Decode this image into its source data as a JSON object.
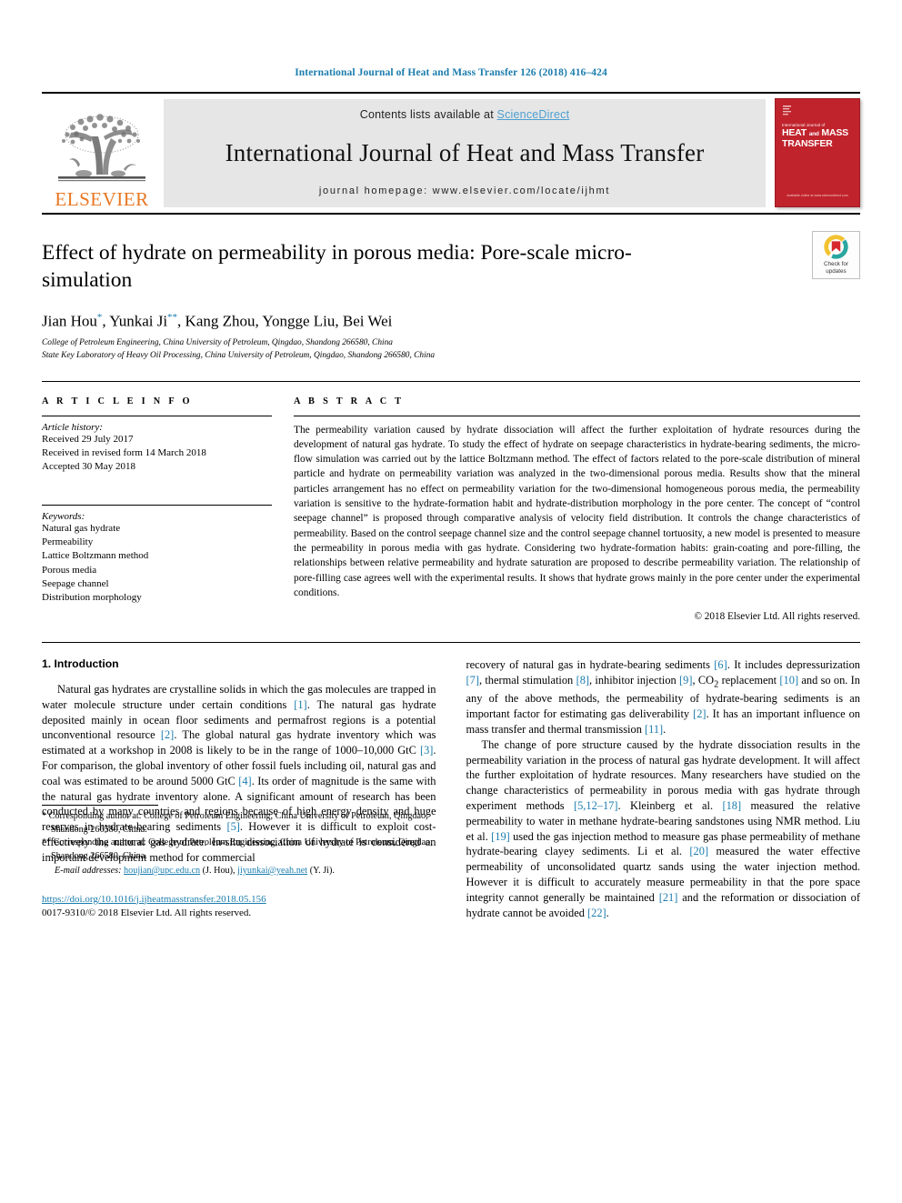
{
  "running_head": "International Journal of Heat and Mass Transfer 126 (2018) 416–424",
  "masthead": {
    "publisher_name": "ELSEVIER",
    "contents_prefix": "Contents lists available at ",
    "sciencedirect": "ScienceDirect",
    "journal_title": "International Journal of Heat and Mass Transfer",
    "homepage": "journal homepage: www.elsevier.com/locate/ijhmt",
    "cover": {
      "sub": "International Journal of",
      "line1": "HEAT",
      "line_and": "and",
      "line2": "MASS",
      "line3": "TRANSFER",
      "footer": "Available online at www.sciencedirect.com"
    },
    "accent_color": "#c0232c",
    "link_color": "#4c9fd0",
    "elsevier_orange": "#E87722"
  },
  "badge": {
    "line1": "Check for",
    "line2": "updates"
  },
  "article": {
    "title": "Effect of hydrate on permeability in porous media: Pore-scale micro-simulation",
    "authors_html": "Jian Hou, Yunkai Ji, Kang Zhou, Yongge Liu, Bei Wei",
    "affiliation_1": "College of Petroleum Engineering, China University of Petroleum, Qingdao, Shandong 266580, China",
    "affiliation_2": "State Key Laboratory of Heavy Oil Processing, China University of Petroleum, Qingdao, Shandong 266580, China"
  },
  "info": {
    "heading": "A R T I C L E   I N F O",
    "history_label": "Article history:",
    "history": [
      "Received 29 July 2017",
      "Received in revised form 14 March 2018",
      "Accepted 30 May 2018"
    ],
    "keywords_label": "Keywords:",
    "keywords": [
      "Natural gas hydrate",
      "Permeability",
      "Lattice Boltzmann method",
      "Porous media",
      "Seepage channel",
      "Distribution morphology"
    ]
  },
  "abstract": {
    "heading": "A B S T R A C T",
    "text": "The permeability variation caused by hydrate dissociation will affect the further exploitation of hydrate resources during the development of natural gas hydrate. To study the effect of hydrate on seepage characteristics in hydrate-bearing sediments, the micro-flow simulation was carried out by the lattice Boltzmann method. The effect of factors related to the pore-scale distribution of mineral particle and hydrate on permeability variation was analyzed in the two-dimensional porous media. Results show that the mineral particles arrangement has no effect on permeability variation for the two-dimensional homogeneous porous media, the permeability variation is sensitive to the hydrate-formation habit and hydrate-distribution morphology in the pore center. The concept of “control seepage channel” is proposed through comparative analysis of velocity field distribution. It controls the change characteristics of permeability. Based on the control seepage channel size and the control seepage channel tortuosity, a new model is presented to measure the permeability in porous media with gas hydrate. Considering two hydrate-formation habits: grain-coating and pore-filling, the relationships between relative permeability and hydrate saturation are proposed to describe permeability variation. The relationship of pore-filling case agrees well with the experimental results. It shows that hydrate grows mainly in the pore center under the experimental conditions.",
    "copyright": "© 2018 Elsevier Ltd. All rights reserved."
  },
  "intro": {
    "heading": "1. Introduction",
    "left_p1": "Natural gas hydrates are crystalline solids in which the gas molecules are trapped in water molecule structure under certain conditions [1]. The natural gas hydrate deposited mainly in ocean floor sediments and permafrost regions is a potential unconventional resource [2]. The global natural gas hydrate inventory which was estimated at a workshop in 2008 is likely to be in the range of 1000–10,000 GtC [3]. For comparison, the global inventory of other fossil fuels including oil, natural gas and coal was estimated to be around 5000 GtC [4]. Its order of magnitude is the same with the natural gas hydrate inventory alone. A significant amount of research has been conducted by many countries and regions because of high energy density and huge reserves in hydrate-bearing sediments [5]. However it is difficult to exploit cost-effectively the natural gas hydrate. In-situ dissociation of hydrate is considered an important development method for commercial",
    "right_p1": "recovery of natural gas in hydrate-bearing sediments [6]. It includes depressurization [7], thermal stimulation [8], inhibitor injection [9], CO2 replacement [10] and so on. In any of the above methods, the permeability of hydrate-bearing sediments is an important factor for estimating gas deliverability [2]. It has an important influence on mass transfer and thermal transmission [11].",
    "right_p2": "The change of pore structure caused by the hydrate dissociation results in the permeability variation in the process of natural gas hydrate development. It will affect the further exploitation of hydrate resources. Many researchers have studied on the change characteristics of permeability in porous media with gas hydrate through experiment methods [5,12–17]. Kleinberg et al. [18] measured the relative permeability to water in methane hydrate-bearing sandstones using NMR method. Liu et al. [19] used the gas injection method to measure gas phase permeability of methane hydrate-bearing clayey sediments. Li et al. [20] measured the water effective permeability of unconsolidated quartz sands using the water injection method. However it is difficult to accurately measure permeability in that the pore space integrity cannot generally be maintained [21] and the reformation or dissociation of hydrate cannot be avoided [22]."
  },
  "footnotes": {
    "note1": "* Corresponding author at: College of Petroleum Engineering, China University of Petroleum, Qingdao, Shandong 266580, China.",
    "note2": "** Corresponding author at: College of Petroleum Engineering, China University of Petroleum, Qingdao, Shandong 266580, China.",
    "email_label": "E-mail addresses:",
    "email1": "houjian@upc.edu.cn",
    "email1_who": "(J. Hou),",
    "email2": "jiyunkai@yeah.net",
    "email2_who": "(Y. Ji).",
    "doi": "https://doi.org/10.1016/j.ijheatmasstransfer.2018.05.156",
    "issn": "0017-9310/© 2018 Elsevier Ltd. All rights reserved."
  }
}
